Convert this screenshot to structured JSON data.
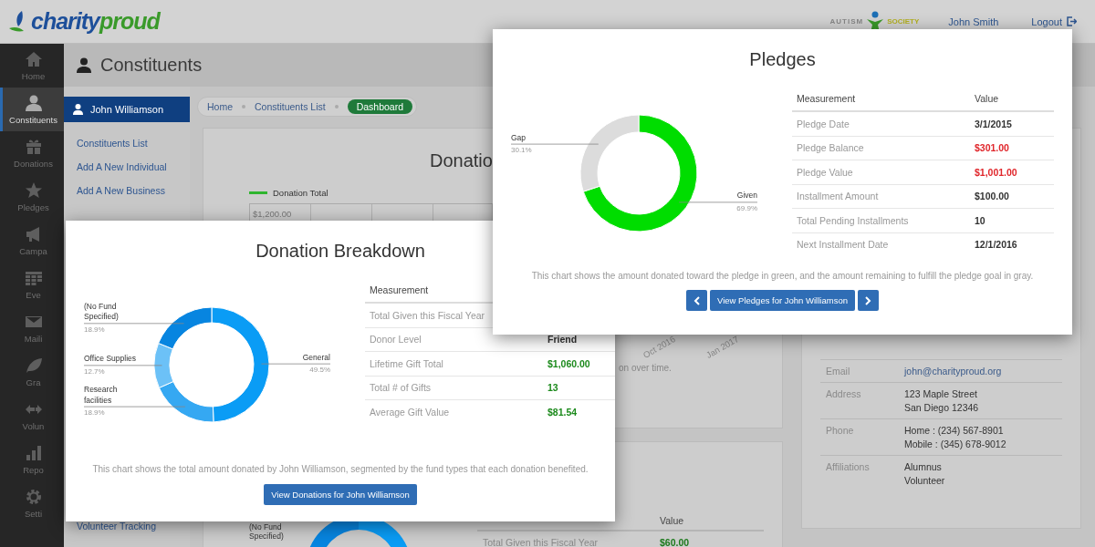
{
  "header": {
    "logo": {
      "first": "charity",
      "second": "proud"
    },
    "partner_logo": {
      "first": "AUTISM",
      "second": "SOCIETY"
    },
    "user_name": "John Smith",
    "logout": "Logout"
  },
  "nav": [
    {
      "label": "Home",
      "selected": false
    },
    {
      "label": "Constituents",
      "selected": true
    },
    {
      "label": "Donations",
      "selected": false
    },
    {
      "label": "Pledges",
      "selected": false
    },
    {
      "label": "Campa",
      "selected": false
    },
    {
      "label": "Eve",
      "selected": false
    },
    {
      "label": "Maili",
      "selected": false
    },
    {
      "label": "Gra",
      "selected": false
    },
    {
      "label": "Volun",
      "selected": false
    },
    {
      "label": "Repo",
      "selected": false
    },
    {
      "label": "Setti",
      "selected": false
    }
  ],
  "page_title": "Constituents",
  "sub_sidebar": {
    "header": "John Williamson",
    "links": [
      "Constituents List",
      "Add A New Individual",
      "Add A New Business"
    ],
    "bottom_link": "Volunteer Tracking"
  },
  "breadcrumb": [
    {
      "label": "Home",
      "selected": false
    },
    {
      "label": "Constituents List",
      "selected": false
    },
    {
      "label": "Dashboard",
      "selected": true
    }
  ],
  "history_card": {
    "title": "Donatio",
    "legend": "Donation Total",
    "axis_label": "$1,200.00",
    "x_labels": [
      "Oct 2016",
      "Jan 2017"
    ],
    "caption": "on over time."
  },
  "lower_card": {
    "chart_label": "(No Fund Specified)",
    "value_header": "Value",
    "row_label": "Total Given this Fiscal Year",
    "row_value": "$60.00"
  },
  "contact": [
    {
      "label": "Email",
      "lines": [
        "john@charityproud.org"
      ],
      "kind": "link"
    },
    {
      "label": "Address",
      "lines": [
        "123 Maple Street",
        "San Diego 12346"
      ],
      "kind": "text"
    },
    {
      "label": "Phone",
      "lines": [
        "Home : (234) 567-8901",
        "Mobile : (345) 678-9012"
      ],
      "kind": "text"
    },
    {
      "label": "Affiliations",
      "lines": [
        "Alumnus",
        "Volunteer"
      ],
      "kind": "text"
    }
  ],
  "donation_card": {
    "title": "Donation Breakdown",
    "chart_data": {
      "type": "donut",
      "categories": [
        "General",
        "Research facilities",
        "Office Supplies",
        "(No Fund Specified)"
      ],
      "values": [
        49.5,
        18.9,
        12.7,
        18.9
      ],
      "colors": [
        "#0a9cf5",
        "#35a8f2",
        "#6cc1f7",
        "#0785e0"
      ],
      "value_labels": [
        "49.5%",
        "18.9%",
        "12.7%",
        "18.9%"
      ]
    },
    "table": {
      "columns": [
        "Measurement"
      ],
      "rows": [
        {
          "label": "Total Given this Fiscal Year"
        },
        {
          "label": "Donor Level",
          "value": "Friend",
          "kind": "neutral"
        },
        {
          "label": "Lifetime Gift Total",
          "value": "$1,060.00",
          "kind": "positive"
        },
        {
          "label": "Total # of Gifts",
          "value": "13",
          "kind": "positive"
        },
        {
          "label": "Average Gift Value",
          "value": "$81.54",
          "kind": "positive"
        }
      ]
    },
    "caption": "This chart shows the total amount donated by John Williamson, segmented by the fund types that each donation benefited.",
    "button": "View Donations for John Williamson"
  },
  "pledges_card": {
    "title": "Pledges",
    "chart_data": {
      "type": "donut",
      "categories": [
        "Given",
        "Gap"
      ],
      "values": [
        69.9,
        30.1
      ],
      "colors": [
        "#00dd00",
        "#dcdcdc"
      ],
      "value_labels": [
        "69.9%",
        "30.1%"
      ]
    },
    "table": {
      "columns": [
        "Measurement",
        "Value"
      ],
      "rows": [
        {
          "label": "Pledge Date",
          "value": "3/1/2015",
          "kind": "neutral"
        },
        {
          "label": "Pledge Balance",
          "value": "$301.00",
          "kind": "negative"
        },
        {
          "label": "Pledge Value",
          "value": "$1,001.00",
          "kind": "negative"
        },
        {
          "label": "Installment Amount",
          "value": "$100.00",
          "kind": "neutral"
        },
        {
          "label": "Total Pending Installments",
          "value": "10",
          "kind": "neutral"
        },
        {
          "label": "Next Installment Date",
          "value": "12/1/2016",
          "kind": "neutral"
        }
      ]
    },
    "caption": "This chart shows the amount donated toward the pledge in green, and the amount remaining to fulfill the pledge goal in gray.",
    "button": "View Pledges for John Williamson"
  }
}
